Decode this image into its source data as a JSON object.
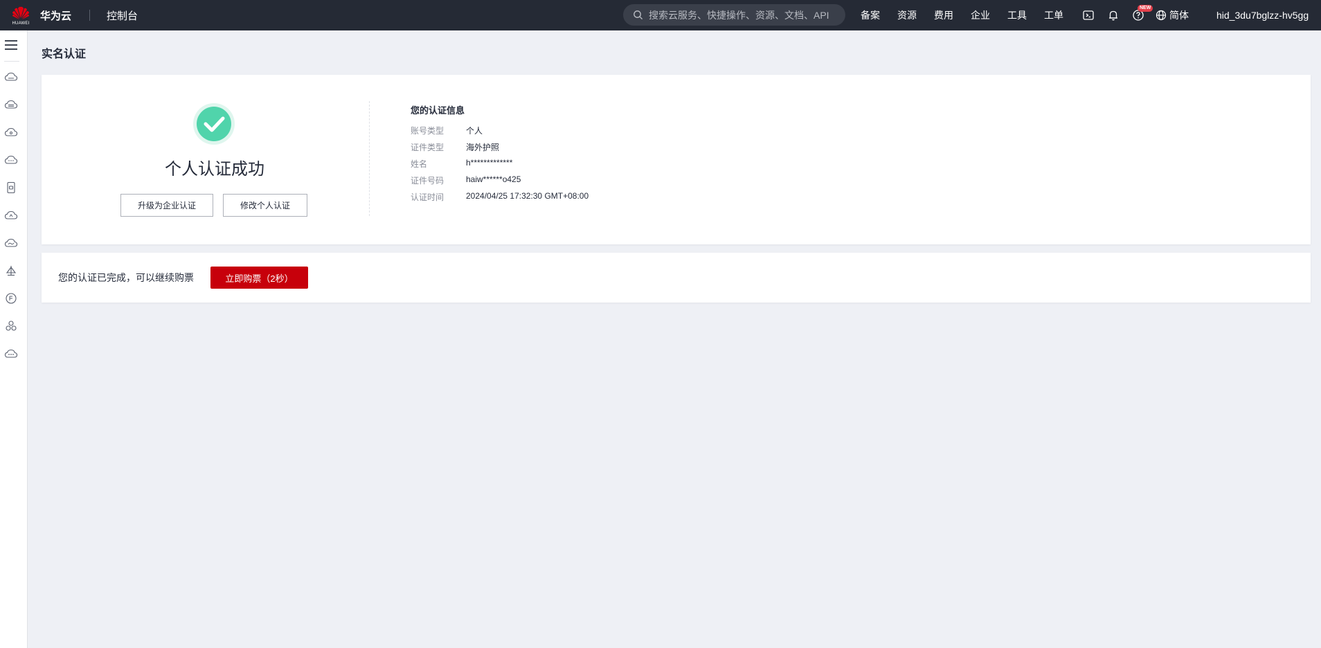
{
  "header": {
    "logo_text": "HUAWEI",
    "brand": "华为云",
    "console": "控制台",
    "search_placeholder": "搜索云服务、快捷操作、资源、文档、API",
    "nav": [
      "备案",
      "资源",
      "费用",
      "企业",
      "工具",
      "工单"
    ],
    "icons": [
      "terminal-icon",
      "bell-icon",
      "help-icon"
    ],
    "help_badge": "NEW",
    "language": "简体",
    "username": "hid_3du7bglzz-hv5gg"
  },
  "sidebar": {
    "icons": [
      "menu-icon",
      "cloud-service-icon",
      "cloud-storage-icon",
      "cloud-network-icon",
      "cloud-db-icon",
      "document-icon",
      "cloud-security-icon",
      "cloud-monitor-icon",
      "deploy-icon",
      "chat-icon",
      "cluster-icon",
      "cloud-more-icon"
    ]
  },
  "page": {
    "title": "实名认证",
    "success_title": "个人认证成功",
    "upgrade_button": "升级为企业认证",
    "modify_button": "修改个人认证",
    "info": {
      "title": "您的认证信息",
      "rows": [
        {
          "label": "账号类型",
          "value": "个人"
        },
        {
          "label": "证件类型",
          "value": "海外护照"
        },
        {
          "label": "姓名",
          "value": "h*************"
        },
        {
          "label": "证件号码",
          "value": "haiw******o425"
        },
        {
          "label": "认证时间",
          "value": "2024/04/25 17:32:30 GMT+08:00"
        }
      ]
    },
    "complete_text": "您的认证已完成，可以继续购票",
    "buy_button": "立即购票（2秒）"
  },
  "colors": {
    "topbar_bg": "#252a35",
    "accent_red": "#c7000b",
    "success_green": "#50d4ab",
    "page_bg": "#eef0f5"
  }
}
